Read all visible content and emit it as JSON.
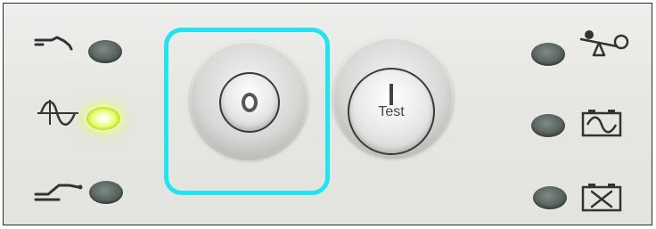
{
  "panel": {
    "left_indicators": [
      {
        "icon": "utility-power-icon",
        "state": "off"
      },
      {
        "icon": "sine-wave-icon",
        "state": "on"
      },
      {
        "icon": "bypass-icon",
        "state": "off"
      }
    ],
    "right_indicators": [
      {
        "icon": "overload-icon",
        "state": "off"
      },
      {
        "icon": "battery-charge-icon",
        "state": "off"
      },
      {
        "icon": "replace-battery-icon",
        "state": "off"
      }
    ],
    "buttons": {
      "off": {
        "symbol": "O",
        "highlighted": true
      },
      "test": {
        "symbol": "I",
        "label": "Test"
      }
    },
    "colors": {
      "highlight": "#22e3f0",
      "led_on": "#e6ff6a",
      "led_off": "#5b6562"
    }
  }
}
